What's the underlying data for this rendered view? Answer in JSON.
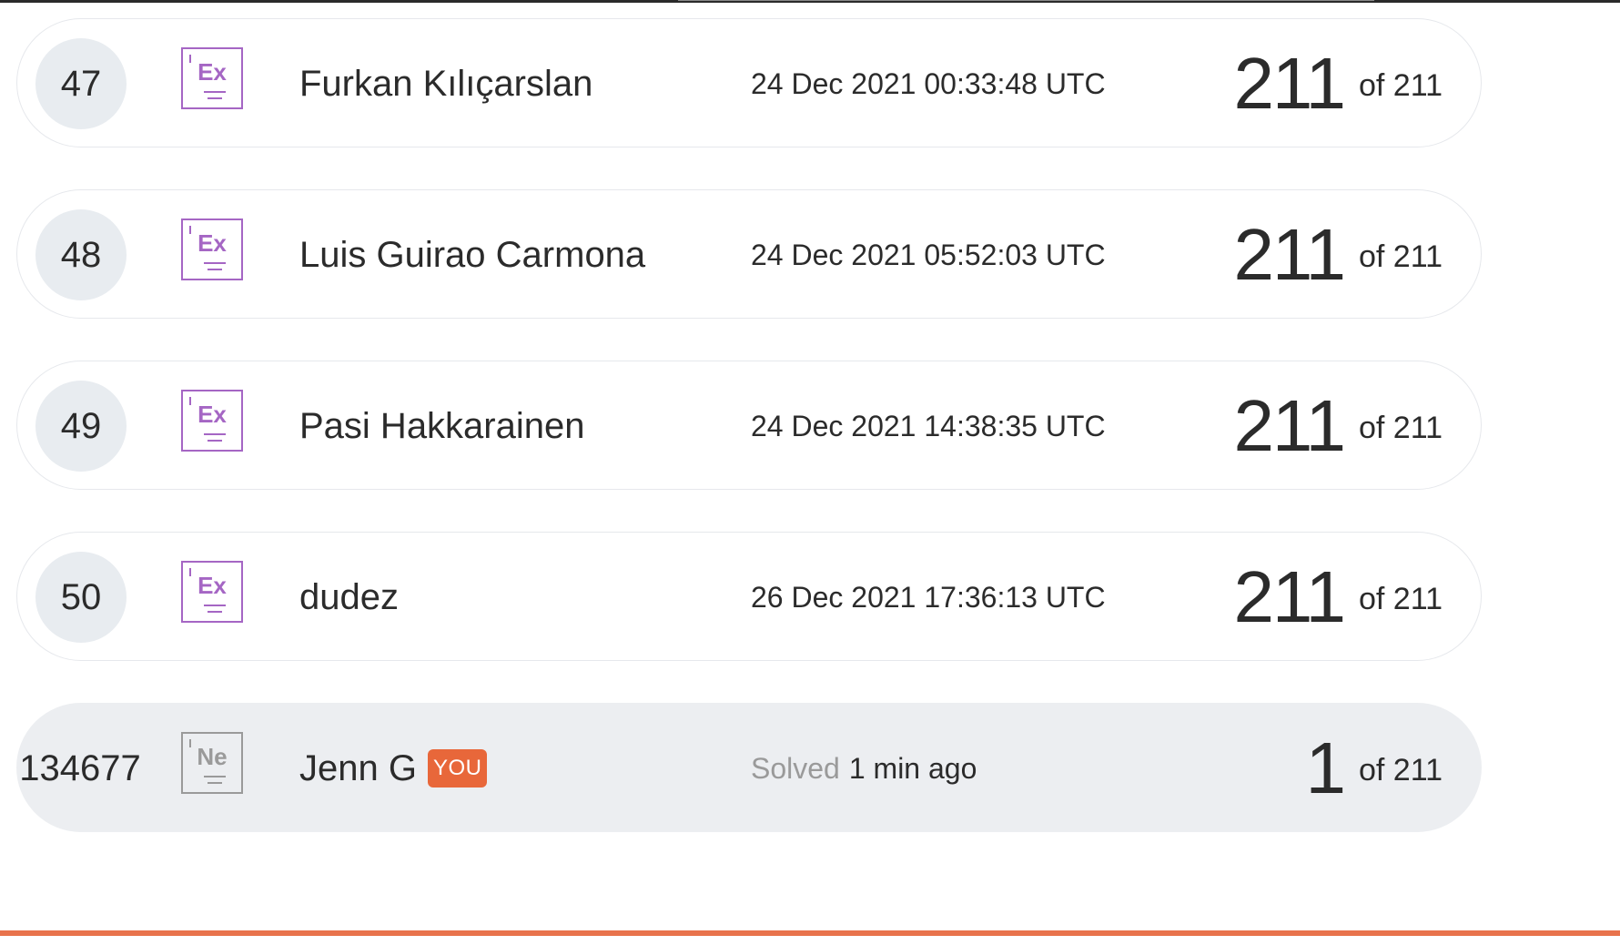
{
  "leaderboard": {
    "rows": [
      {
        "rank": "47",
        "badge": "Ex",
        "name": "Furkan Kılıçarslan",
        "time": "24 Dec 2021 00:33:48 UTC",
        "score": "211",
        "total": "of 211"
      },
      {
        "rank": "48",
        "badge": "Ex",
        "name": "Luis Guirao Carmona",
        "time": "24 Dec 2021 05:52:03 UTC",
        "score": "211",
        "total": "of 211"
      },
      {
        "rank": "49",
        "badge": "Ex",
        "name": "Pasi Hakkarainen",
        "time": "24 Dec 2021 14:38:35 UTC",
        "score": "211",
        "total": "of 211"
      },
      {
        "rank": "50",
        "badge": "Ex",
        "name": "dudez",
        "time": "26 Dec 2021 17:36:13 UTC",
        "score": "211",
        "total": "of 211"
      }
    ],
    "current_user": {
      "rank": "134677",
      "badge": "Ne",
      "name": "Jenn G",
      "you_label": "YOU",
      "solved_label": "Solved",
      "solved_time": "1 min ago",
      "score": "1",
      "total": "of 211"
    }
  },
  "colors": {
    "accent": "#e8673a",
    "badge_expert": "#a566c4",
    "badge_newbie": "#9a9a9a",
    "row_highlight": "#eceef1",
    "bottom_rule": "#e8734c"
  },
  "icons": {
    "expert": "element-badge-icon",
    "newbie": "element-badge-icon"
  }
}
